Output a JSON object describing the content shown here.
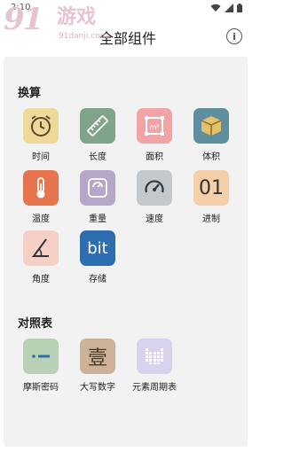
{
  "status_bar": {
    "time": "2:10"
  },
  "watermark": {
    "big": "91",
    "name": "游戏",
    "url": "91danji.com"
  },
  "app_bar": {
    "title": "全部组件"
  },
  "sections": [
    {
      "title": "换算",
      "items": [
        {
          "label": "时间",
          "icon": "clock-icon",
          "color": "#efd99a"
        },
        {
          "label": "长度",
          "icon": "ruler-icon",
          "color": "#7fa48a"
        },
        {
          "label": "面积",
          "icon": "area-square-icon",
          "color": "#f2a3a5"
        },
        {
          "label": "体积",
          "icon": "cube-icon",
          "color": "#5f8f9e"
        },
        {
          "label": "温度",
          "icon": "thermometer-icon",
          "color": "#e6754e"
        },
        {
          "label": "重量",
          "icon": "scale-icon",
          "color": "#b6a7c9"
        },
        {
          "label": "速度",
          "icon": "speedometer-icon",
          "color": "#c3c9cd"
        },
        {
          "label": "进制",
          "icon": "binary-icon",
          "color": "#f4cfa8",
          "glyph": "01"
        },
        {
          "label": "角度",
          "icon": "angle-icon",
          "color": "#f6cfc7"
        },
        {
          "label": "存储",
          "icon": "storage-bit-icon",
          "color": "#2e6eb0",
          "glyph": "bit"
        }
      ]
    },
    {
      "title": "对照表",
      "items": [
        {
          "label": "摩斯密码",
          "icon": "morse-code-icon",
          "color": "#b8d0b4"
        },
        {
          "label": "大写数字",
          "icon": "chinese-numeral-icon",
          "color": "#cdb29a",
          "glyph": "壹"
        },
        {
          "label": "元素周期表",
          "icon": "periodic-table-icon",
          "color": "#d9d2ee"
        }
      ]
    }
  ]
}
